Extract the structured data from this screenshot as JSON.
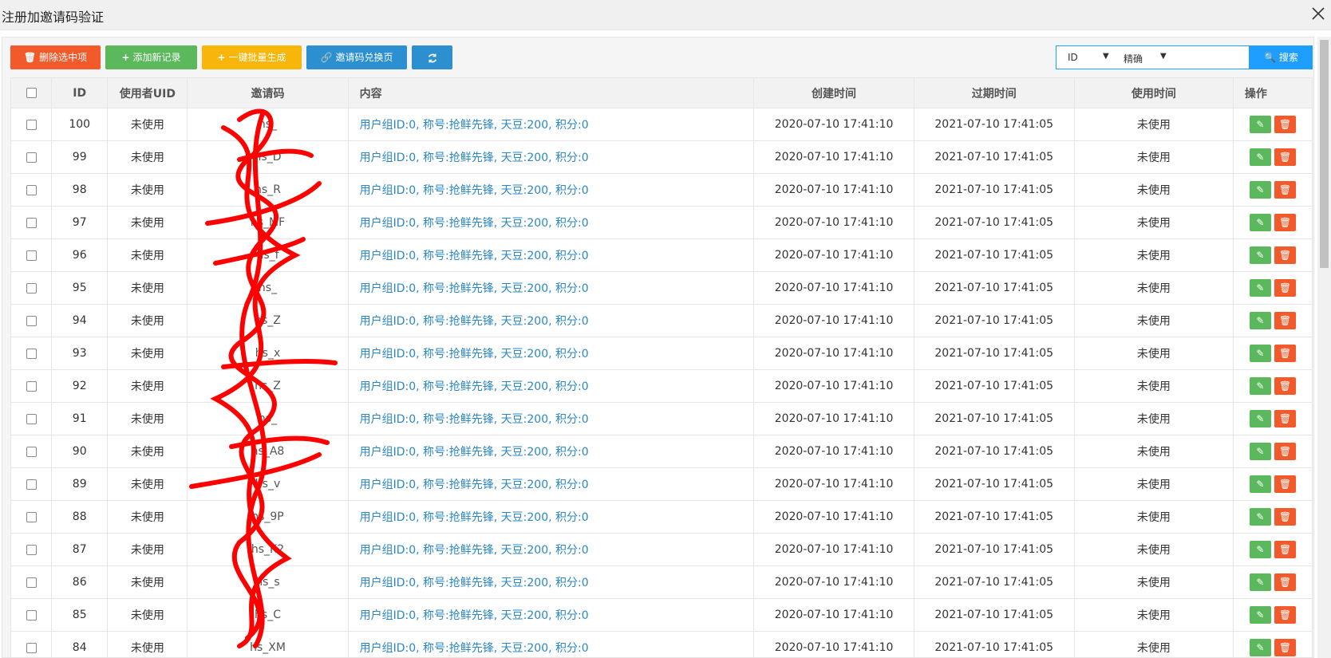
{
  "window": {
    "title": "注册加邀请码验证",
    "close_icon": "close-icon"
  },
  "toolbar": {
    "delete_label": "删除选中项",
    "add_label": "添加新记录",
    "batch_label": "一键批量生成",
    "page_label": "邀请码兑换页",
    "colors": {
      "delete": "#f35a2b",
      "add": "#5cb85c",
      "batch": "#f8b60b",
      "page": "#2c8fd0"
    }
  },
  "search": {
    "field_value": "ID",
    "mode_value": "精确",
    "button_label": "搜索"
  },
  "table": {
    "headers": [
      "",
      "ID",
      "使用者UID",
      "邀请码",
      "内容",
      "创建时间",
      "过期时间",
      "使用时间",
      "操作"
    ],
    "rows": [
      {
        "id": "100",
        "uid": "未使用",
        "code": "hs_",
        "content": "用户组ID:0, 称号:抢鲜先锋, 天豆:200, 积分:0",
        "created": "2020-07-10 17:41:10",
        "expires": "2021-07-10 17:41:05",
        "used": "未使用"
      },
      {
        "id": "99",
        "uid": "未使用",
        "code": "hs_D",
        "content": "用户组ID:0, 称号:抢鲜先锋, 天豆:200, 积分:0",
        "created": "2020-07-10 17:41:10",
        "expires": "2021-07-10 17:41:05",
        "used": "未使用"
      },
      {
        "id": "98",
        "uid": "未使用",
        "code": "hs_R",
        "content": "用户组ID:0, 称号:抢鲜先锋, 天豆:200, 积分:0",
        "created": "2020-07-10 17:41:10",
        "expires": "2021-07-10 17:41:05",
        "used": "未使用"
      },
      {
        "id": "97",
        "uid": "未使用",
        "code": "hs_MF",
        "content": "用户组ID:0, 称号:抢鲜先锋, 天豆:200, 积分:0",
        "created": "2020-07-10 17:41:10",
        "expires": "2021-07-10 17:41:05",
        "used": "未使用"
      },
      {
        "id": "96",
        "uid": "未使用",
        "code": "hs_f",
        "content": "用户组ID:0, 称号:抢鲜先锋, 天豆:200, 积分:0",
        "created": "2020-07-10 17:41:10",
        "expires": "2021-07-10 17:41:05",
        "used": "未使用"
      },
      {
        "id": "95",
        "uid": "未使用",
        "code": "hs_",
        "content": "用户组ID:0, 称号:抢鲜先锋, 天豆:200, 积分:0",
        "created": "2020-07-10 17:41:10",
        "expires": "2021-07-10 17:41:05",
        "used": "未使用"
      },
      {
        "id": "94",
        "uid": "未使用",
        "code": "hs_Z",
        "content": "用户组ID:0, 称号:抢鲜先锋, 天豆:200, 积分:0",
        "created": "2020-07-10 17:41:10",
        "expires": "2021-07-10 17:41:05",
        "used": "未使用"
      },
      {
        "id": "93",
        "uid": "未使用",
        "code": "hs_x",
        "content": "用户组ID:0, 称号:抢鲜先锋, 天豆:200, 积分:0",
        "created": "2020-07-10 17:41:10",
        "expires": "2021-07-10 17:41:05",
        "used": "未使用"
      },
      {
        "id": "92",
        "uid": "未使用",
        "code": "hs_Z",
        "content": "用户组ID:0, 称号:抢鲜先锋, 天豆:200, 积分:0",
        "created": "2020-07-10 17:41:10",
        "expires": "2021-07-10 17:41:05",
        "used": "未使用"
      },
      {
        "id": "91",
        "uid": "未使用",
        "code": "hs_",
        "content": "用户组ID:0, 称号:抢鲜先锋, 天豆:200, 积分:0",
        "created": "2020-07-10 17:41:10",
        "expires": "2021-07-10 17:41:05",
        "used": "未使用"
      },
      {
        "id": "90",
        "uid": "未使用",
        "code": "hs_A8",
        "content": "用户组ID:0, 称号:抢鲜先锋, 天豆:200, 积分:0",
        "created": "2020-07-10 17:41:10",
        "expires": "2021-07-10 17:41:05",
        "used": "未使用"
      },
      {
        "id": "89",
        "uid": "未使用",
        "code": "hs_v",
        "content": "用户组ID:0, 称号:抢鲜先锋, 天豆:200, 积分:0",
        "created": "2020-07-10 17:41:10",
        "expires": "2021-07-10 17:41:05",
        "used": "未使用"
      },
      {
        "id": "88",
        "uid": "未使用",
        "code": "hs_9P",
        "content": "用户组ID:0, 称号:抢鲜先锋, 天豆:200, 积分:0",
        "created": "2020-07-10 17:41:10",
        "expires": "2021-07-10 17:41:05",
        "used": "未使用"
      },
      {
        "id": "87",
        "uid": "未使用",
        "code": "hs_K2",
        "content": "用户组ID:0, 称号:抢鲜先锋, 天豆:200, 积分:0",
        "created": "2020-07-10 17:41:10",
        "expires": "2021-07-10 17:41:05",
        "used": "未使用"
      },
      {
        "id": "86",
        "uid": "未使用",
        "code": "hs_s",
        "content": "用户组ID:0, 称号:抢鲜先锋, 天豆:200, 积分:0",
        "created": "2020-07-10 17:41:10",
        "expires": "2021-07-10 17:41:05",
        "used": "未使用"
      },
      {
        "id": "85",
        "uid": "未使用",
        "code": "hs_C",
        "content": "用户组ID:0, 称号:抢鲜先锋, 天豆:200, 积分:0",
        "created": "2020-07-10 17:41:10",
        "expires": "2021-07-10 17:41:05",
        "used": "未使用"
      },
      {
        "id": "84",
        "uid": "未使用",
        "code": "hs_XM",
        "content": "用户组ID:0, 称号:抢鲜先锋, 天豆:200, 积分:0",
        "created": "2020-07-10 17:41:10",
        "expires": "2021-07-10 17:41:05",
        "used": "未使用"
      }
    ]
  },
  "redaction_color": "#ff0000"
}
